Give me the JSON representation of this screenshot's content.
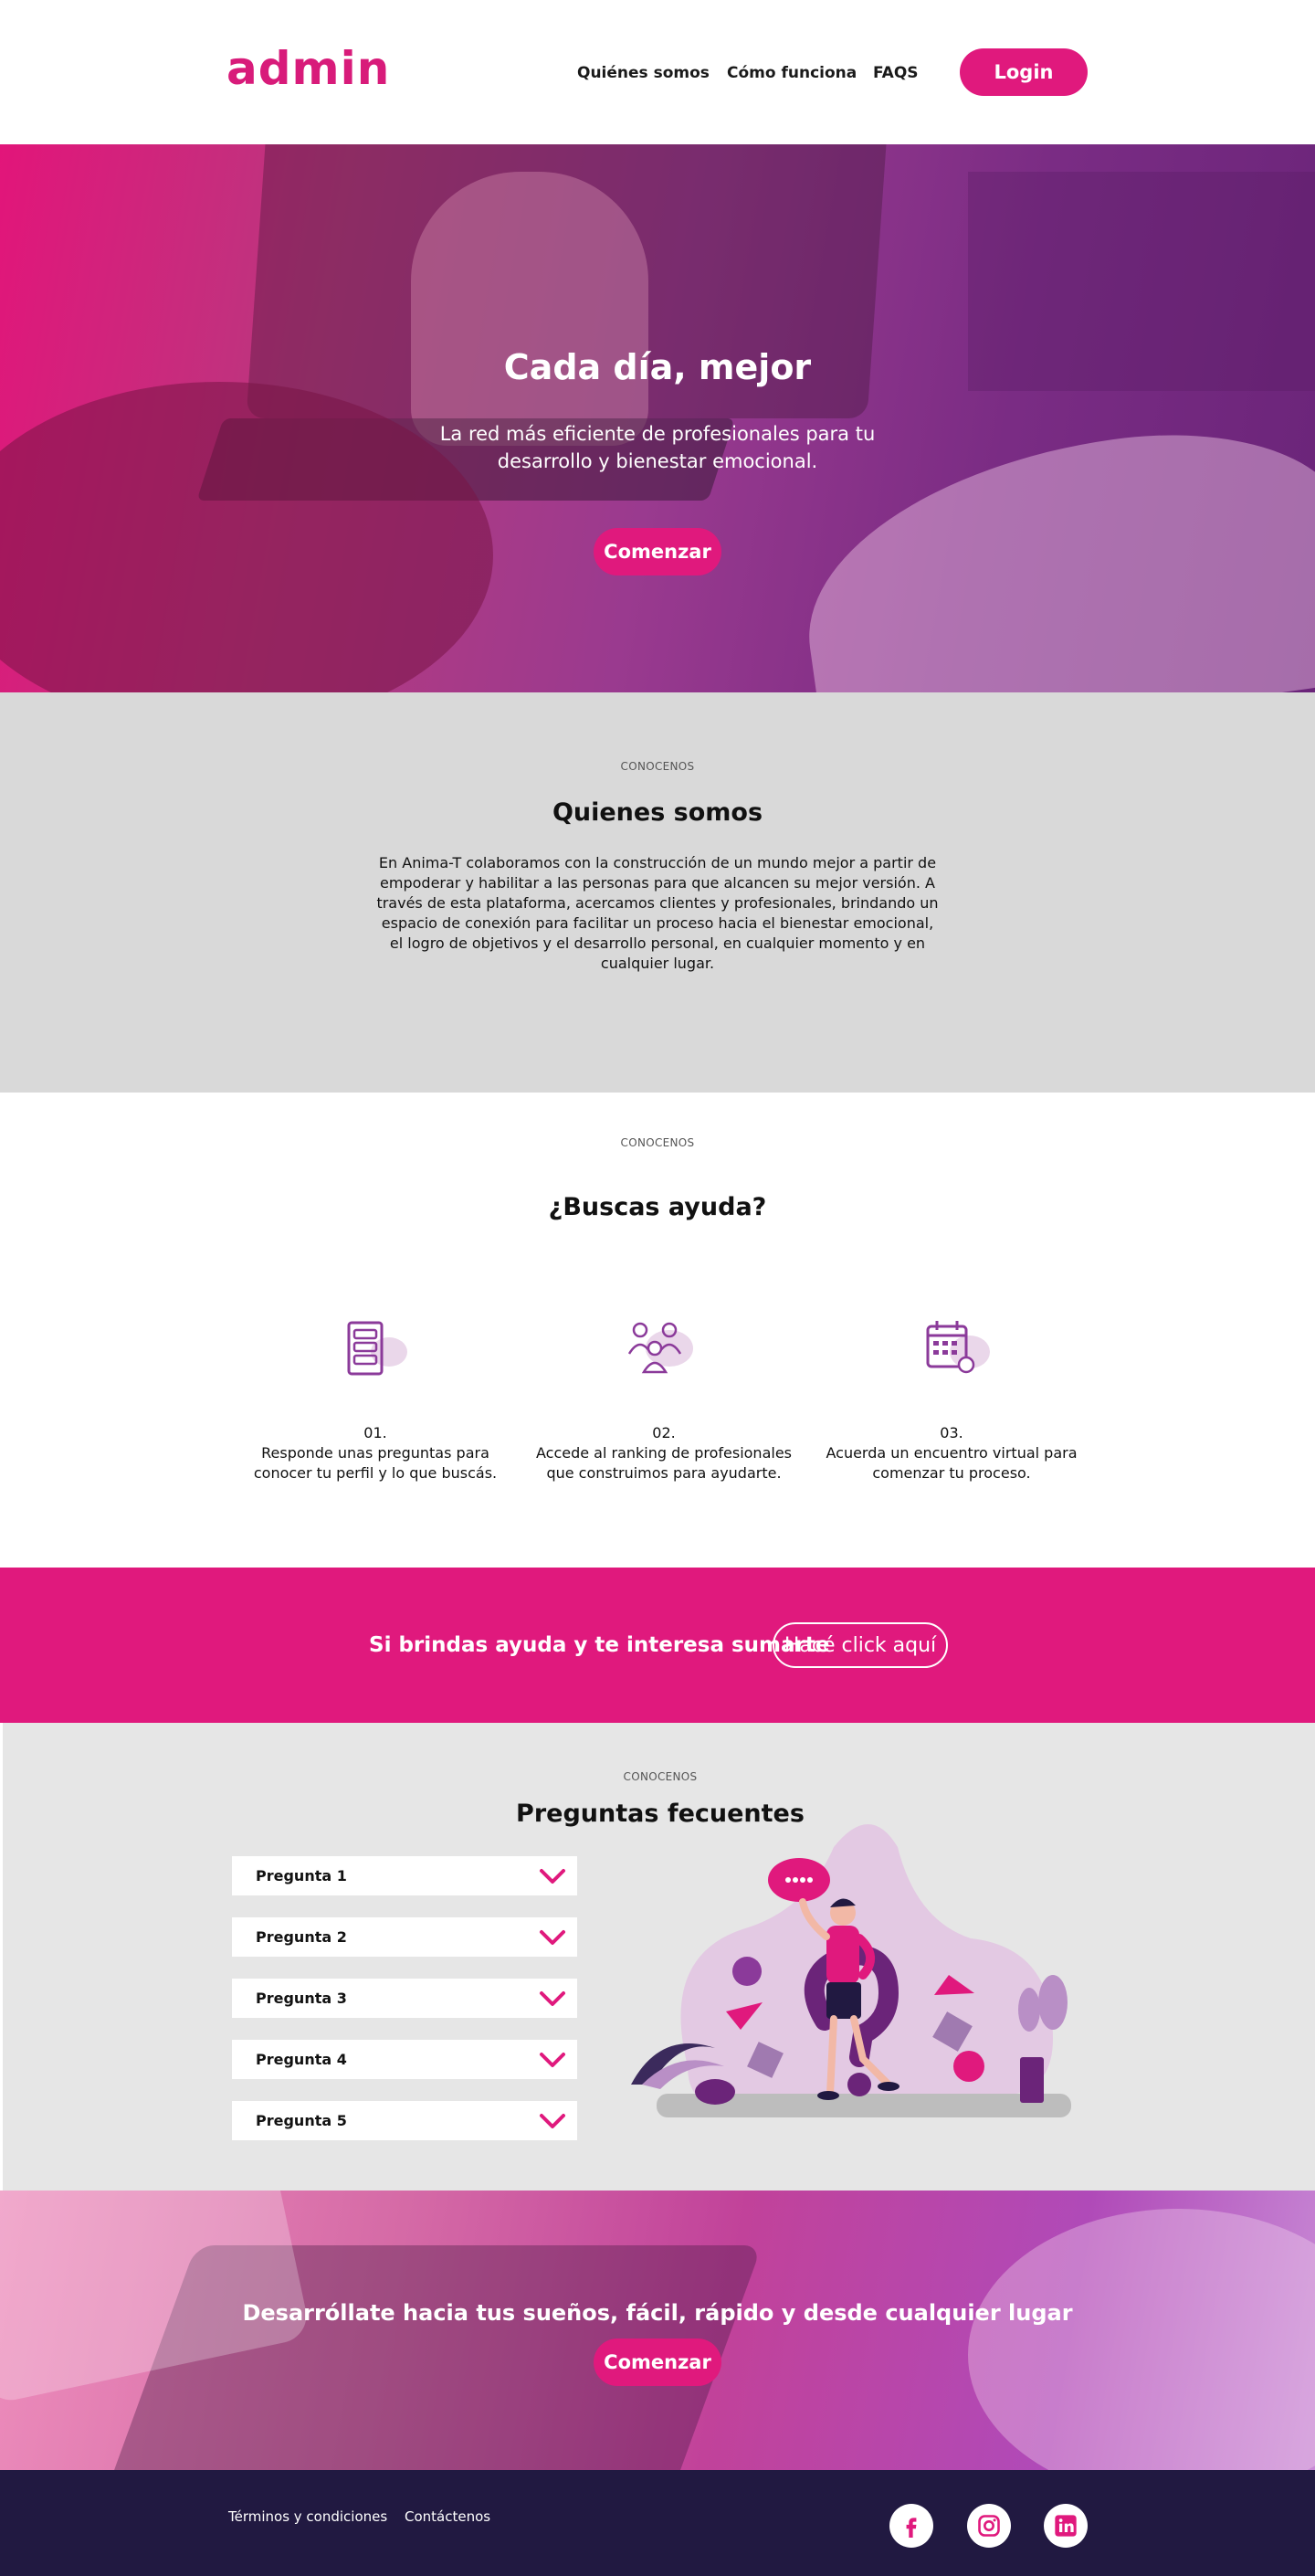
{
  "brand": {
    "logo": "admin",
    "accent": "#e0197d",
    "dark": "#211941"
  },
  "header": {
    "nav": [
      "Quiénes somos",
      "Cómo funciona",
      "FAQS"
    ],
    "login_label": "Login"
  },
  "hero": {
    "title": "Cada día, mejor",
    "subtitle": "La red más eficiente de profesionales para tu desarrollo y bienestar emocional.",
    "cta_label": "Comenzar"
  },
  "about": {
    "eyebrow": "CONOCENOS",
    "title": "Quienes somos",
    "text": "En Anima-T colaboramos con la construcción de un mundo mejor a partir de empoderar y habilitar a las personas para que alcancen su mejor versión. A través de esta plataforma, acercamos clientes y profesionales, brindando un espacio de conexión para facilitar un proceso hacia el bienestar emocional, el logro de objetivos y el desarrollo personal, en cualquier momento y en cualquier lugar."
  },
  "help": {
    "eyebrow": "CONOCENOS",
    "title": "¿Buscas ayuda?",
    "steps": [
      {
        "number": "01.",
        "text": "Responde unas preguntas para conocer tu perfil y lo que buscás.",
        "icon": "list-icon"
      },
      {
        "number": "02.",
        "text": "Accede al ranking de profesionales que construimos para ayudarte.",
        "icon": "people-icon"
      },
      {
        "number": "03.",
        "text": "Acuerda un encuentro virtual para comenzar tu proceso.",
        "icon": "calendar-icon"
      }
    ]
  },
  "banner": {
    "text": "Si brindas ayuda y te interesa sumarte",
    "button_label": "Hacé click aquí"
  },
  "faq": {
    "eyebrow": "CONOCENOS",
    "title": "Preguntas fecuentes",
    "items": [
      "Pregunta 1",
      "Pregunta 2",
      "Pregunta 3",
      "Pregunta 4",
      "Pregunta 5"
    ]
  },
  "cta": {
    "title": "Desarróllate hacia tus sueños, fácil, rápido y desde cualquier lugar",
    "button_label": "Comenzar"
  },
  "footer": {
    "links": [
      "Términos y condiciones",
      "Contáctenos"
    ],
    "social": [
      "facebook-icon",
      "instagram-icon",
      "linkedin-icon"
    ]
  }
}
